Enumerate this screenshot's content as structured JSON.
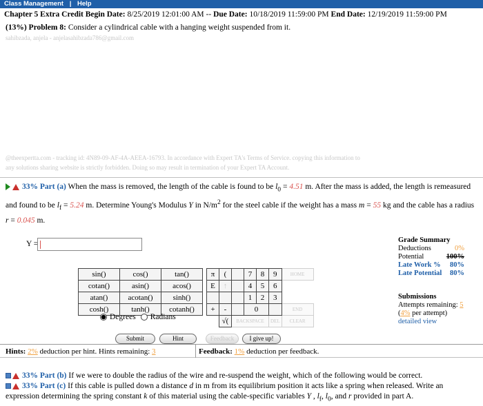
{
  "menu": {
    "items": [
      "Class Management",
      "|",
      "Help"
    ]
  },
  "header": {
    "chapter": "Chapter 5 Extra Credit",
    "begin_label": "Begin Date:",
    "begin_date": "8/25/2019 12:01:00 AM",
    "sep": "--",
    "due_label": "Due Date:",
    "due_date": "10/18/2019 11:59:00 PM",
    "end_label": "End Date:",
    "end_date": "12/19/2019 11:59:00 PM"
  },
  "problem": {
    "weight": "(13%)",
    "label": "Problem 8:",
    "text": "Consider a cylindrical cable with a hanging weight suspended from it.",
    "email": "sahibzada, anjela - anjelasahibzada786@gmail.com"
  },
  "tracking": {
    "line1": "@theexpertta.com - tracking id: 4N89-09-AF-4A-AEEA-16793. In accordance with Expert TA's Terms of Service. copying this information to",
    "line2": "any solutions sharing website is strictly forbidden. Doing so may result in termination of your Expert TA Account."
  },
  "part_a": {
    "pct": "33%",
    "label": "Part (a)",
    "t1": "When the mass is removed, the length of the cable is found to be ",
    "l0_sym": "l",
    "l0_sub": "0",
    "l0_val": "4.51",
    "t2": " m. After the mass is added, the length is remeasured and found to be ",
    "lf_sym": "l",
    "lf_sub": "f",
    "lf_val": "5.24",
    "t3": " m. Determine Young's Modulus ",
    "y_sym": "Y",
    "t4": " in N/m",
    "t4_sup": "2",
    "t5": " for the steel cable if the weight has a mass ",
    "m_sym": "m",
    "m_val": "55",
    "t6": " kg and the cable has a radius ",
    "r_sym": "r",
    "r_val": "0.045",
    "t7": " m."
  },
  "answer": {
    "label": "Y =",
    "value": ""
  },
  "keypad": {
    "fn_rows": [
      [
        "sin()",
        "cos()",
        "tan()"
      ],
      [
        "cotan()",
        "asin()",
        "acos()"
      ],
      [
        "atan()",
        "acotan()",
        "sinh()"
      ],
      [
        "cosh()",
        "tanh()",
        "cotanh()"
      ]
    ],
    "sym_rows": [
      [
        "π",
        "("
      ],
      [
        "E",
        "↑"
      ],
      [
        "",
        ""
      ],
      [
        "+",
        "-"
      ]
    ],
    "num_rows": [
      [
        "7",
        "8",
        "9"
      ],
      [
        "4",
        "5",
        "6"
      ],
      [
        "1",
        "2",
        "3"
      ]
    ],
    "zero": "0",
    "sqrt": "√(",
    "ghost": {
      "home": "HOME",
      "end": "END",
      "backspace": "BACKSPACE",
      "del": "DEL",
      "clear": "CLEAR"
    },
    "degrees": "Degrees",
    "radians": "Radians"
  },
  "buttons": {
    "submit": "Submit",
    "hint": "Hint",
    "feedback": "Feedback",
    "give_up": "I give up!"
  },
  "grade": {
    "title": "Grade Summary",
    "deductions_label": "Deductions",
    "deductions_val": "0%",
    "potential_label": "Potential",
    "potential_val": "100%",
    "late_work_label": "Late Work %",
    "late_work_val": "80%",
    "late_potential_label": "Late Potential",
    "late_potential_val": "80%",
    "submissions_title": "Submissions",
    "attempts_label": "Attempts remaining:",
    "attempts_val": "5",
    "per_attempt_val": "4%",
    "per_attempt_label": "per attempt)",
    "detailed_view": "detailed view"
  },
  "hints": {
    "label": "Hints:",
    "pct": "2%",
    "text": " deduction per hint. Hints remaining: ",
    "remaining": "3"
  },
  "feedback": {
    "label": "Feedback:",
    "pct": "1%",
    "text": " deduction per feedback."
  },
  "part_b": {
    "pct": "33%",
    "label": "Part (b)",
    "text": "If we were to double the radius of the wire and re-suspend the weight, which of the following would be correct."
  },
  "part_c": {
    "pct": "33%",
    "label": "Part (c)",
    "t1": "If this cable is pulled down a distance ",
    "d": "d",
    "t2": " in m from its equilibrium position it acts like a spring when released. Write an expression determining the spring constant ",
    "k": "k",
    "t3": " of this material using the cable-specific variables ",
    "vars": "Y , l",
    "lf_sub": "f",
    "v2": ", l",
    "l0_sub": "0",
    "v3": ", and ",
    "r": "r",
    "t4": " provided in part A."
  },
  "colors": {
    "accent": "#1f5fa8",
    "red": "#d9534f",
    "orange": "#f0a040"
  }
}
